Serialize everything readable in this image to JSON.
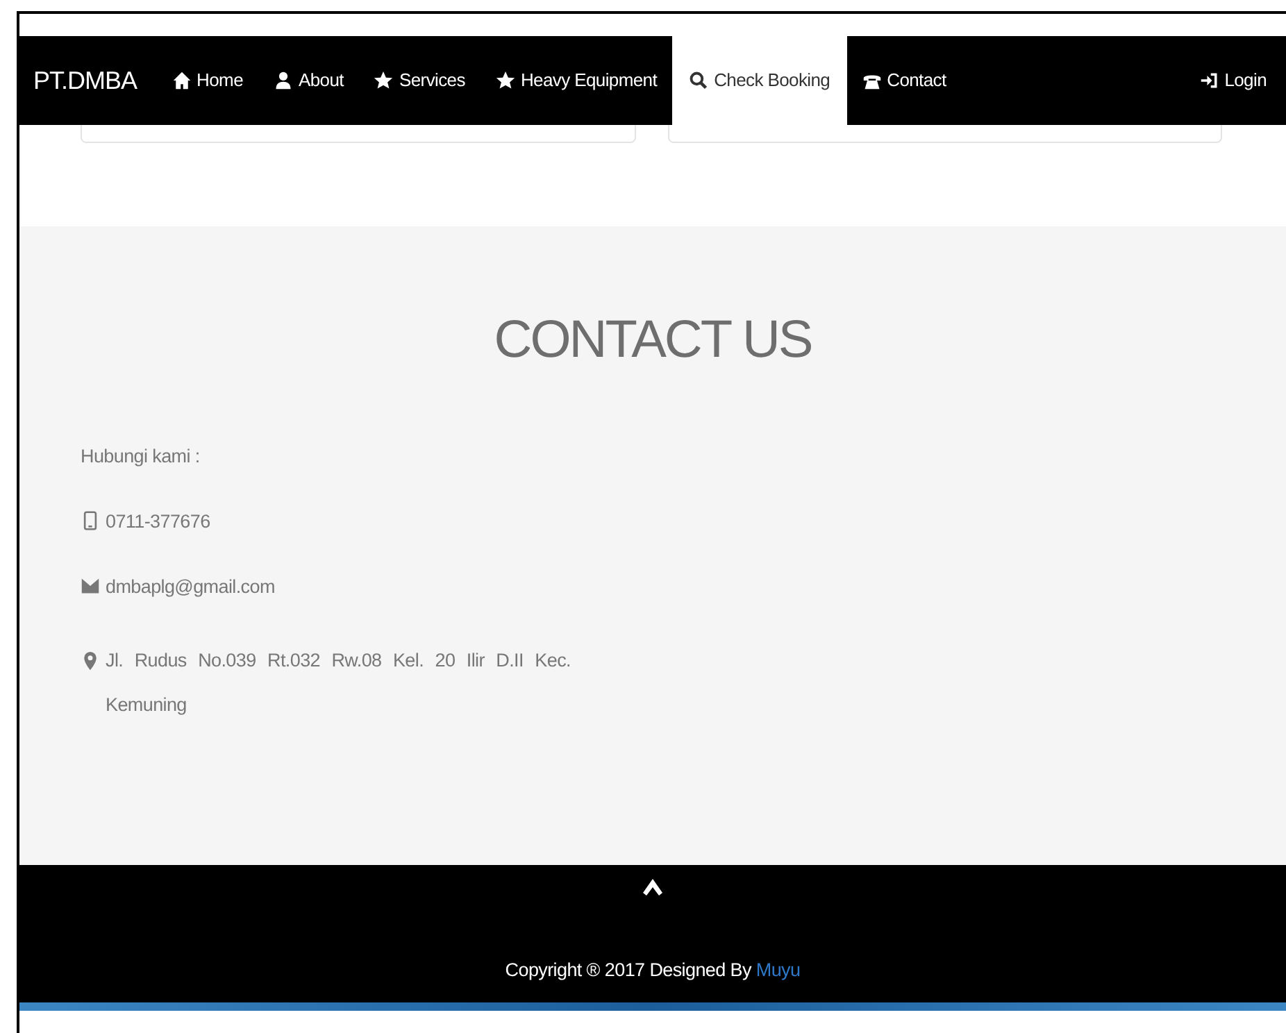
{
  "navbar": {
    "brand": "PT.DMBA",
    "items": [
      {
        "label": "Home",
        "kind": "home",
        "selected": false
      },
      {
        "label": "About",
        "kind": "user",
        "selected": false
      },
      {
        "label": "Services",
        "kind": "star",
        "selected": false
      },
      {
        "label": "Heavy Equipment",
        "kind": "star",
        "selected": false
      },
      {
        "label": "Check Booking",
        "kind": "search",
        "selected": true
      },
      {
        "label": "Contact",
        "kind": "phone",
        "selected": false
      }
    ],
    "right_item": {
      "label": "Login",
      "kind": "login"
    }
  },
  "contact": {
    "title": "CONTACT US",
    "intro": "Hubungi kami :",
    "lines": [
      {
        "kind": "mobile",
        "text": "0711-377676"
      },
      {
        "kind": "envelope",
        "text": "dmbaplg@gmail.com"
      },
      {
        "kind": "marker",
        "text": "Jl. Rudus No.039 Rt.032 Rw.08 Kel. 20 Ilir D.II Kec. Kemuning"
      }
    ]
  },
  "footer": {
    "copyright": "Copyright ® 2017 Designed By",
    "author_link": "Muyu"
  }
}
